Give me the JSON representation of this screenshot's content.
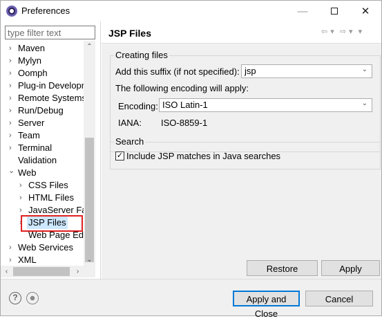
{
  "window": {
    "title": "Preferences",
    "minimize_glyph": "—",
    "close_glyph": "✕"
  },
  "filter": {
    "placeholder": "type filter text"
  },
  "tree": {
    "items": [
      {
        "label": "Maven",
        "arrow": "›"
      },
      {
        "label": "Mylyn",
        "arrow": "›"
      },
      {
        "label": "Oomph",
        "arrow": "›"
      },
      {
        "label": "Plug-in Developr",
        "arrow": "›"
      },
      {
        "label": "Remote Systems",
        "arrow": "›"
      },
      {
        "label": "Run/Debug",
        "arrow": "›"
      },
      {
        "label": "Server",
        "arrow": "›"
      },
      {
        "label": "Team",
        "arrow": "›"
      },
      {
        "label": "Terminal",
        "arrow": "›"
      },
      {
        "label": "Validation",
        "arrow": ""
      },
      {
        "label": "Web",
        "arrow": "⌄"
      },
      {
        "label": "CSS Files",
        "arrow": "›"
      },
      {
        "label": "HTML Files",
        "arrow": "›"
      },
      {
        "label": "JavaServer Fac",
        "arrow": "›"
      },
      {
        "label": "JSP Files",
        "arrow": "›"
      },
      {
        "label": "Web Page Edi",
        "arrow": ""
      },
      {
        "label": "Web Services",
        "arrow": "›"
      },
      {
        "label": "XML",
        "arrow": "›"
      }
    ],
    "scroll_up": "⌃",
    "scroll_down": "⌄",
    "scroll_left": "‹",
    "scroll_right": "›"
  },
  "page": {
    "title": "JSP Files",
    "nav": {
      "back": "⇦",
      "back_menu": "▾",
      "forward": "⇨",
      "forward_menu": "▾",
      "menu": "▾"
    }
  },
  "creating_files": {
    "title": "Creating files",
    "suffix_label": "Add this suffix (if not specified):",
    "suffix_value": "jsp",
    "encoding_intro": "The following encoding will apply:",
    "encoding_label": "Encoding:",
    "encoding_value": "ISO Latin-1",
    "iana_label": "IANA:",
    "iana_value": "ISO-8859-1"
  },
  "search": {
    "title": "Search",
    "checkbox_label": "Include JSP matches in Java searches",
    "checkbox_mark": "✓"
  },
  "buttons": {
    "restore_defaults": "Restore Defaults",
    "apply": "Apply",
    "apply_and_close": "Apply and Close",
    "cancel": "Cancel"
  },
  "icons": {
    "help": "?"
  },
  "colors": {
    "selection": "#cde8ff",
    "highlight_border": "#e02020",
    "default_button_border": "#0078d7"
  }
}
